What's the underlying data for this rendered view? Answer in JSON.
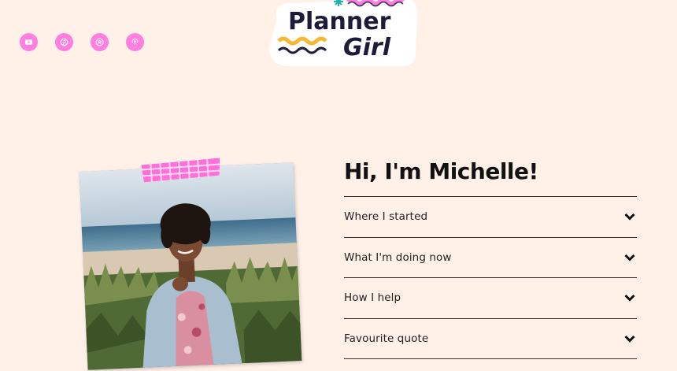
{
  "header": {
    "logo_text_line1": "Planner",
    "logo_text_line2": "Girl",
    "social_links": [
      {
        "icon": "youtube-icon"
      },
      {
        "icon": "pinterest-icon"
      },
      {
        "icon": "spotify-icon"
      },
      {
        "icon": "podcast-icon"
      }
    ]
  },
  "about": {
    "heading": "Hi, I'm Michelle!",
    "items": [
      {
        "label": "Where I started"
      },
      {
        "label": "What I'm doing now"
      },
      {
        "label": "How I help"
      },
      {
        "label": "Favourite quote"
      }
    ]
  },
  "colors": {
    "background": "#fff0e8",
    "accent_pink": "#ff7ee0",
    "logo_navy": "#1c1b3a",
    "logo_yellow": "#f7b731",
    "logo_teal": "#1fb5a8"
  }
}
